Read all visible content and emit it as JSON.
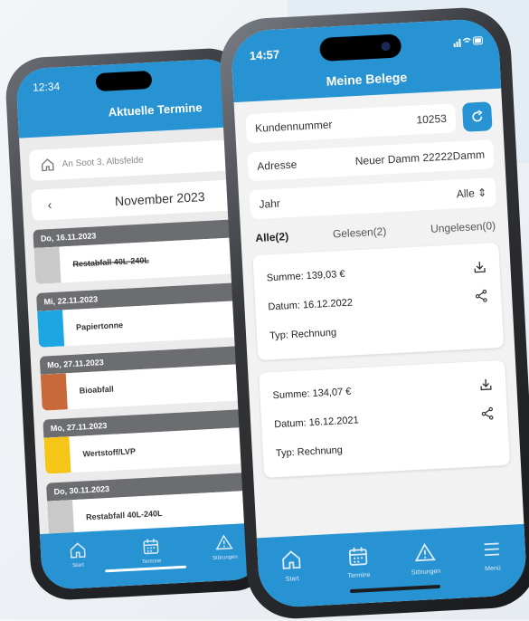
{
  "back_phone": {
    "status_time": "12:34",
    "title": "Aktuelle Termine",
    "location": "An Soot 3, Albsfelde",
    "month": "November 2023",
    "events": [
      {
        "date": "Do, 16.11.2023",
        "label": "Restabfall 40L-240L",
        "color": "#c9c9c9",
        "struck": true
      },
      {
        "date": "Mi, 22.11.2023",
        "label": "Papiertonne",
        "color": "#1ca7e2",
        "struck": false
      },
      {
        "date": "Mo, 27.11.2023",
        "label": "Bioabfall",
        "color": "#c8693a",
        "struck": false
      },
      {
        "date": "Mo, 27.11.2023",
        "label": "Wertstoff/LVP",
        "color": "#f5c518",
        "struck": false
      },
      {
        "date": "Do, 30.11.2023",
        "label": "Restabfall 40L-240L",
        "color": "#c9c9c9",
        "struck": false
      }
    ],
    "tabs": [
      {
        "label": "Start",
        "icon": "home-icon"
      },
      {
        "label": "Termine",
        "icon": "calendar-icon"
      },
      {
        "label": "Störungen",
        "icon": "warning-icon"
      }
    ]
  },
  "front_phone": {
    "status_time": "14:57",
    "title": "Meine Belege",
    "fields": {
      "customer_label": "Kundennummer",
      "customer_value": "10253",
      "address_label": "Adresse",
      "address_value": "Neuer Damm 22222Damm",
      "year_label": "Jahr",
      "year_value": "Alle"
    },
    "filter_tabs": [
      {
        "label": "Alle(2)",
        "active": true
      },
      {
        "label": "Gelesen(2)",
        "active": false
      },
      {
        "label": "Ungelesen(0)",
        "active": false
      }
    ],
    "documents": [
      {
        "sum": "Summe: 139,03 €",
        "date": "Datum: 16.12.2022",
        "type": "Typ: Rechnung"
      },
      {
        "sum": "Summe: 134,07 €",
        "date": "Datum: 16.12.2021",
        "type": "Typ: Rechnung"
      }
    ],
    "tabs": [
      {
        "label": "Start",
        "icon": "home-icon"
      },
      {
        "label": "Termine",
        "icon": "calendar-icon"
      },
      {
        "label": "Störungen",
        "icon": "warning-icon"
      },
      {
        "label": "Menü",
        "icon": "menu-icon"
      }
    ]
  },
  "colors": {
    "brand_blue": "#2893d2",
    "date_header": "#6c6d70"
  }
}
